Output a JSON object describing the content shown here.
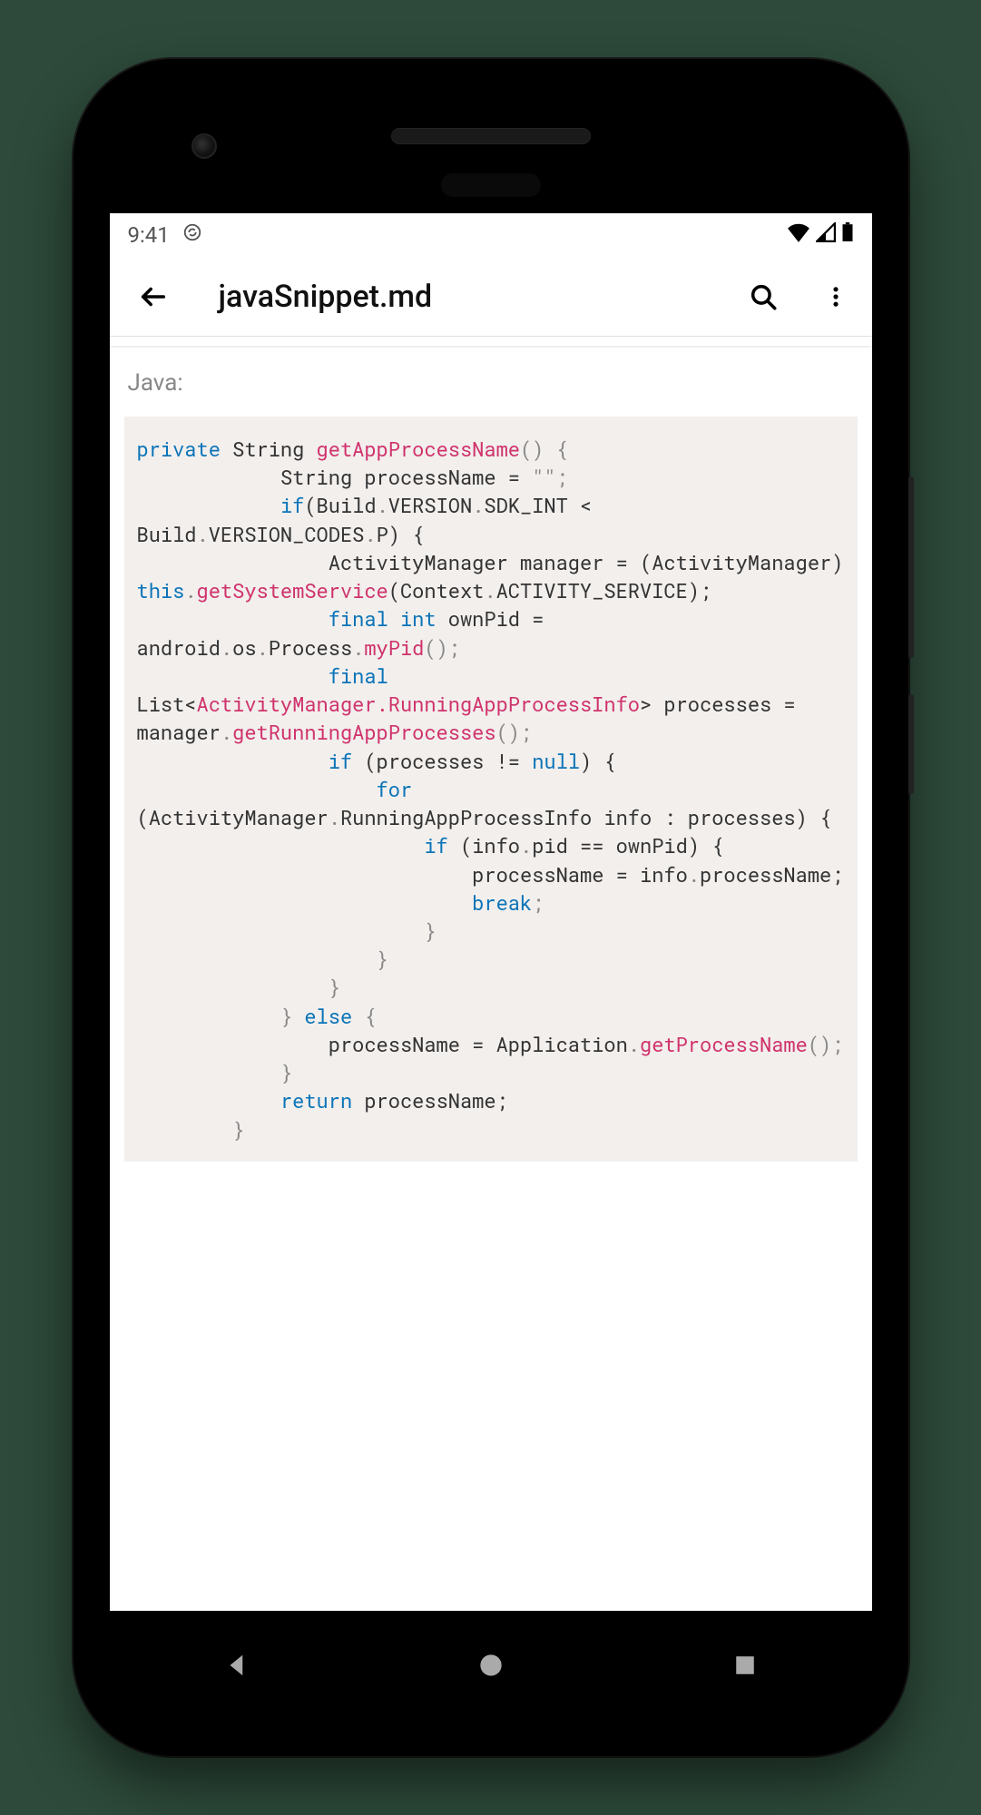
{
  "status": {
    "time": "9:41"
  },
  "appbar": {
    "title": "javaSnippet.md"
  },
  "content": {
    "section_label": "Java:"
  },
  "code": {
    "t01a": "private",
    "t01b": " String ",
    "t01c": "getAppProcessName",
    "t01d": "() {",
    "t02": "            String processName = ",
    "t02s": "\"\"",
    "t02e": ";",
    "t03a": "            ",
    "t03b": "if",
    "t03c": "(Build",
    "t03d": ".",
    "t03e": "VERSION",
    "t03f": ".",
    "t03g": "SDK_INT < Build",
    "t03h": ".",
    "t03i": "VERSION_CODES",
    "t03j": ".",
    "t03k": "P) {",
    "t04": "                ActivityManager manager = (ActivityManager) ",
    "t05a": "this",
    "t05b": ".",
    "t05c": "getSystemService",
    "t05d": "(Context",
    "t05e": ".",
    "t05f": "ACTIVITY_SERVICE);",
    "t06a": "                ",
    "t06b": "final int",
    "t06c": " ownPid = android",
    "t06d": ".",
    "t06e": "os",
    "t06f": ".",
    "t06g": "Process",
    "t06h": ".",
    "t06i": "myPid",
    "t06j": "();",
    "t07a": "                ",
    "t07b": "final",
    "t07c": " List<",
    "t07d": "ActivityManager.RunningAppProcessInfo",
    "t07e": "> processes = manager",
    "t07f": ".",
    "t07g": "getRunningAppProcesses",
    "t07h": "();",
    "t08a": "                ",
    "t08b": "if",
    "t08c": " (processes != ",
    "t08d": "null",
    "t08e": ") {",
    "t09a": "                    ",
    "t09b": "for",
    "t09c": " (ActivityManager",
    "t09d": ".",
    "t09e": "RunningAppProcessInfo info : processes) {",
    "t10a": "                        ",
    "t10b": "if",
    "t10c": " (info",
    "t10d": ".",
    "t10e": "pid == ownPid) {",
    "t11": "                            processName = info",
    "t11b": ".",
    "t11c": "processName;",
    "t12a": "                            ",
    "t12b": "break",
    "t12c": ";",
    "t13": "                        }",
    "t14": "                    }",
    "t15": "                }",
    "t16a": "            } ",
    "t16b": "else",
    "t16c": " {",
    "t17": "                processName = Application",
    "t17b": ".",
    "t17c": "getProcessName",
    "t17d": "();",
    "t18": "            }",
    "t19a": "            ",
    "t19b": "return",
    "t19c": " processName;",
    "t20": "        }"
  }
}
